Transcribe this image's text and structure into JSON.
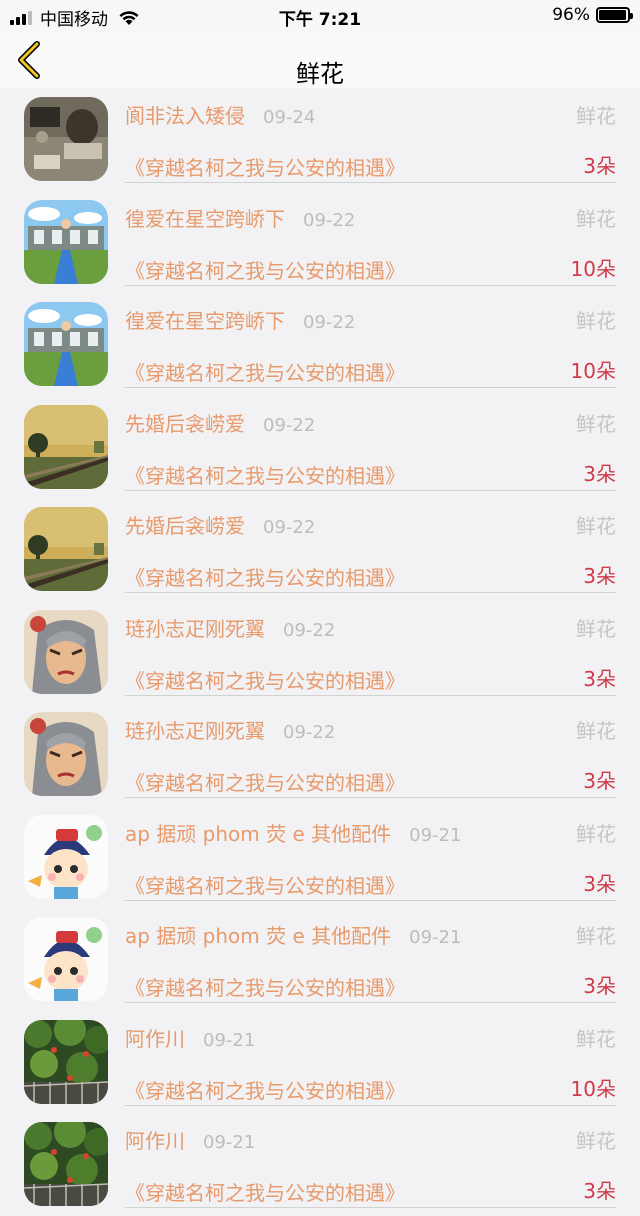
{
  "status_bar": {
    "carrier": "中国移动",
    "time": "下午 7:21",
    "battery": "96%",
    "battery_level": 0.96
  },
  "nav": {
    "title": "鲜花"
  },
  "rows": [
    {
      "name": "阆非法入矮侵",
      "date": "09-24",
      "type": "鲜花",
      "book": "《穿越名柯之我与公安的相遇》",
      "count": "3朵",
      "avatar": "photo-desk-avatar"
    },
    {
      "name": "徨爱在星空跨峤下",
      "date": "09-22",
      "type": "鲜花",
      "book": "《穿越名柯之我与公安的相遇》",
      "count": "10朵",
      "avatar": "cartoon-river-avatar"
    },
    {
      "name": "徨爱在星空跨峤下",
      "date": "09-22",
      "type": "鲜花",
      "book": "《穿越名柯之我与公安的相遇》",
      "count": "10朵",
      "avatar": "cartoon-river-avatar"
    },
    {
      "name": "先婚后衾崂爱",
      "date": "09-22",
      "type": "鲜花",
      "book": "《穿越名柯之我与公安的相遇》",
      "count": "3朵",
      "avatar": "railway-sunset-avatar"
    },
    {
      "name": "先婚后衾崂爱",
      "date": "09-22",
      "type": "鲜花",
      "book": "《穿越名柯之我与公安的相遇》",
      "count": "3朵",
      "avatar": "railway-sunset-avatar"
    },
    {
      "name": "琏孙志疋刚死翼",
      "date": "09-22",
      "type": "鲜花",
      "book": "《穿越名柯之我与公安的相遇》",
      "count": "3朵",
      "avatar": "anime-woman-avatar"
    },
    {
      "name": "琏孙志疋刚死翼",
      "date": "09-22",
      "type": "鲜花",
      "book": "《穿越名柯之我与公安的相遇》",
      "count": "3朵",
      "avatar": "anime-woman-avatar"
    },
    {
      "name": "ap 据顽 phom 荧 e 其他配件",
      "date": "09-21",
      "type": "鲜花",
      "book": "《穿越名柯之我与公安的相遇》",
      "count": "3朵",
      "avatar": "cartoon-child-avatar"
    },
    {
      "name": "ap 据顽 phom 荧 e 其他配件",
      "date": "09-21",
      "type": "鲜花",
      "book": "《穿越名柯之我与公安的相遇》",
      "count": "3朵",
      "avatar": "cartoon-child-avatar"
    },
    {
      "name": "阿作川",
      "date": "09-21",
      "type": "鲜花",
      "book": "《穿越名柯之我与公安的相遇》",
      "count": "10朵",
      "avatar": "green-plants-avatar"
    },
    {
      "name": "阿作川",
      "date": "09-21",
      "type": "鲜花",
      "book": "《穿越名柯之我与公安的相遇》",
      "count": "3朵",
      "avatar": "green-plants-avatar"
    }
  ]
}
